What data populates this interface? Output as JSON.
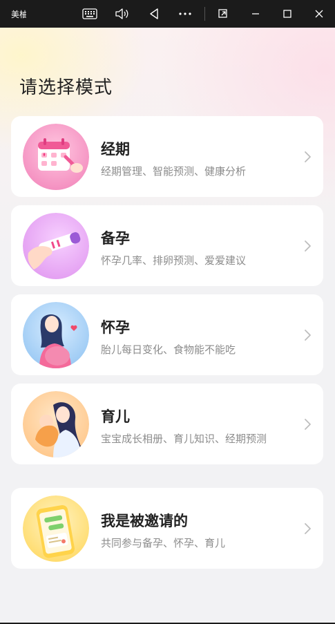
{
  "titlebar": {
    "app_name": "美柚",
    "icons": [
      "keyboard-icon",
      "volume-icon",
      "back-triangle-icon",
      "more-icon",
      "restore-window-icon",
      "minimize-icon",
      "maximize-icon",
      "close-icon"
    ]
  },
  "page_title": "请选择模式",
  "modes": [
    {
      "title": "经期",
      "subtitle": "经期管理、智能预测、健康分析",
      "icon": "calendar-icon"
    },
    {
      "title": "备孕",
      "subtitle": "怀孕几率、排卵预测、爱爱建议",
      "icon": "ovulation-test-icon"
    },
    {
      "title": "怀孕",
      "subtitle": "胎儿每日变化、食物能不能吃",
      "icon": "pregnant-woman-icon"
    },
    {
      "title": "育儿",
      "subtitle": "宝宝成长相册、育儿知识、经期预测",
      "icon": "mother-baby-icon"
    }
  ],
  "invited": {
    "title": "我是被邀请的",
    "subtitle": "共同参与备孕、怀孕、育儿",
    "icon": "phone-chat-icon"
  },
  "colors": {
    "titlebar_bg": "#1b1b1b",
    "card_bg": "#ffffff",
    "page_bg": "#f2f2f4",
    "title_text": "#222222",
    "sub_text": "#8c8c8c"
  }
}
